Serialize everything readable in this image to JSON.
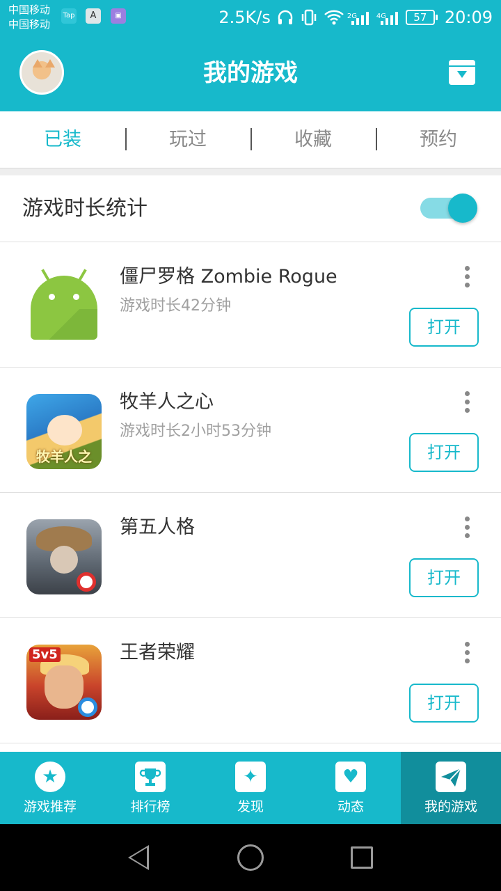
{
  "status_bar": {
    "carrier_1": "中国移动",
    "carrier_2": "中国移动",
    "app_icon_tap": "Tap",
    "app_icon_a": "A",
    "net_speed": "2.5K/s",
    "signal_1_label": "2G",
    "signal_2_label": "4G",
    "battery": "57",
    "time": "20:09"
  },
  "header": {
    "title": "我的游戏"
  },
  "tabs": [
    {
      "label": "已装",
      "active": true
    },
    {
      "label": "玩过",
      "active": false
    },
    {
      "label": "收藏",
      "active": false
    },
    {
      "label": "预约",
      "active": false
    }
  ],
  "stats": {
    "label": "游戏时长统计",
    "enabled": true
  },
  "games": [
    {
      "name": "僵尸罗格 Zombie Rogue",
      "playtime": "游戏时长42分钟",
      "open_label": "打开",
      "icon": "android-icon"
    },
    {
      "name": "牧羊人之心",
      "playtime": "游戏时长2小时53分钟",
      "open_label": "打开",
      "icon": "shepherds-heart-icon",
      "icon_text": "牧羊人之心"
    },
    {
      "name": "第五人格",
      "playtime": "",
      "open_label": "打开",
      "icon": "identity-v-icon"
    },
    {
      "name": "王者荣耀",
      "playtime": "",
      "open_label": "打开",
      "icon": "honor-of-kings-icon",
      "icon_badge": "5v5"
    }
  ],
  "bottom_nav": [
    {
      "label": "游戏推荐",
      "icon": "star-icon",
      "active": false
    },
    {
      "label": "排行榜",
      "icon": "trophy-icon",
      "active": false
    },
    {
      "label": "发现",
      "icon": "sparkle-icon",
      "active": false
    },
    {
      "label": "动态",
      "icon": "heart-icon",
      "active": false
    },
    {
      "label": "我的游戏",
      "icon": "paper-plane-icon",
      "active": true
    }
  ],
  "colors": {
    "accent": "#17b9cb",
    "accent_dark": "#118e9c"
  }
}
